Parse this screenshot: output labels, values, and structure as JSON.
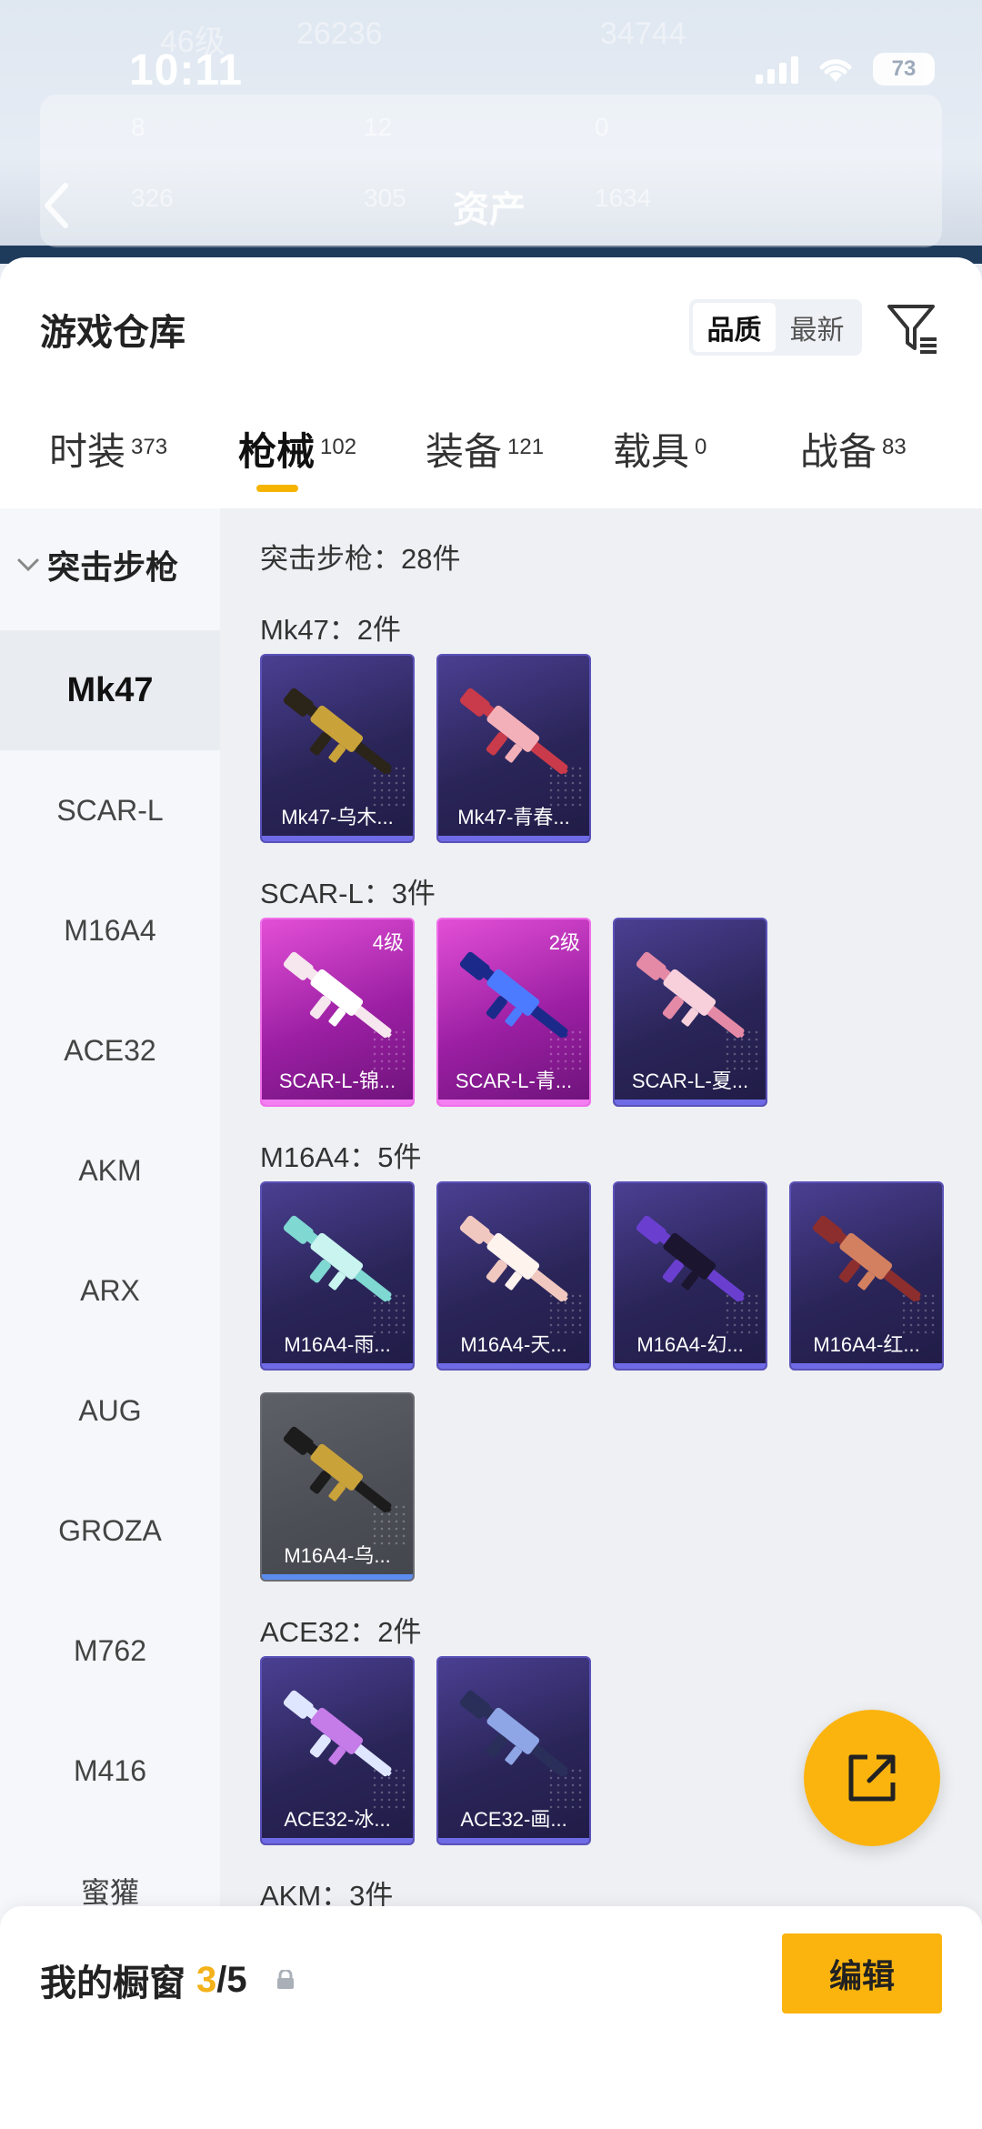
{
  "status_bar": {
    "time": "10:11",
    "battery": "73",
    "ghost_level": "46级",
    "ghost_coins": "26236",
    "ghost_value": "34744"
  },
  "header": {
    "title": "资产",
    "row1": [
      "8",
      "12",
      "0"
    ],
    "row2": [
      "326",
      "305",
      "1634"
    ]
  },
  "sheet": {
    "title": "游戏仓库",
    "sort": [
      "品质",
      "最新"
    ],
    "sort_active": 0
  },
  "tabs": [
    {
      "label": "时装",
      "count": "373"
    },
    {
      "label": "枪械",
      "count": "102"
    },
    {
      "label": "装备",
      "count": "121"
    },
    {
      "label": "载具",
      "count": "0"
    },
    {
      "label": "战备",
      "count": "83"
    }
  ],
  "sidebar": {
    "category": "突击步枪",
    "items": [
      "Mk47",
      "SCAR-L",
      "M16A4",
      "ACE32",
      "AKM",
      "ARX",
      "AUG",
      "GROZA",
      "M762",
      "M416",
      "蜜獾"
    ]
  },
  "main": {
    "summary": "突击步枪：28件",
    "sections": [
      {
        "title": "Mk47：2件",
        "cards": [
          {
            "name": "Mk47-乌木...",
            "rarity": "purple",
            "level": "",
            "colors": [
              "#2b2418",
              "#c9a23a"
            ]
          },
          {
            "name": "Mk47-青春...",
            "rarity": "purple",
            "level": "",
            "colors": [
              "#c93a4a",
              "#f4b0b8"
            ]
          }
        ]
      },
      {
        "title": "SCAR-L：3件",
        "cards": [
          {
            "name": "SCAR-L-锦...",
            "rarity": "pink",
            "level": "4级",
            "colors": [
              "#f6e6ee",
              "#ffffff"
            ]
          },
          {
            "name": "SCAR-L-青...",
            "rarity": "pink",
            "level": "2级",
            "colors": [
              "#1b2a8a",
              "#4d7bff"
            ]
          },
          {
            "name": "SCAR-L-夏...",
            "rarity": "purple",
            "level": "",
            "colors": [
              "#e58aa6",
              "#f7d0dc"
            ]
          }
        ]
      },
      {
        "title": "M16A4：5件",
        "cards": [
          {
            "name": "M16A4-雨...",
            "rarity": "purple",
            "level": "",
            "colors": [
              "#7fd8d2",
              "#c9f4ef"
            ]
          },
          {
            "name": "M16A4-天...",
            "rarity": "purple",
            "level": "",
            "colors": [
              "#f1c8c0",
              "#fff3ee"
            ]
          },
          {
            "name": "M16A4-幻...",
            "rarity": "purple",
            "level": "",
            "colors": [
              "#6a3fd0",
              "#1c1530"
            ]
          },
          {
            "name": "M16A4-红...",
            "rarity": "purple",
            "level": "",
            "colors": [
              "#8c2e2e",
              "#d38060"
            ]
          },
          {
            "name": "M16A4-乌...",
            "rarity": "gray",
            "level": "",
            "colors": [
              "#1c1c1c",
              "#c9a23a"
            ]
          }
        ]
      },
      {
        "title": "ACE32：2件",
        "cards": [
          {
            "name": "ACE32-冰...",
            "rarity": "purple",
            "level": "",
            "colors": [
              "#dfe6ff",
              "#c57be8"
            ]
          },
          {
            "name": "ACE32-画...",
            "rarity": "purple",
            "level": "",
            "colors": [
              "#2a2f5a",
              "#8fa6e6"
            ]
          }
        ]
      },
      {
        "title": "AKM：3件",
        "cards": []
      }
    ]
  },
  "bottom": {
    "showcase_label": "我的橱窗",
    "showcase_current": "3",
    "showcase_total": "/5",
    "edit_label": "编辑"
  },
  "colors": {
    "accent": "#fbb40e",
    "purple_card": "#2a2558",
    "pink_card": "#9b1fa3"
  }
}
